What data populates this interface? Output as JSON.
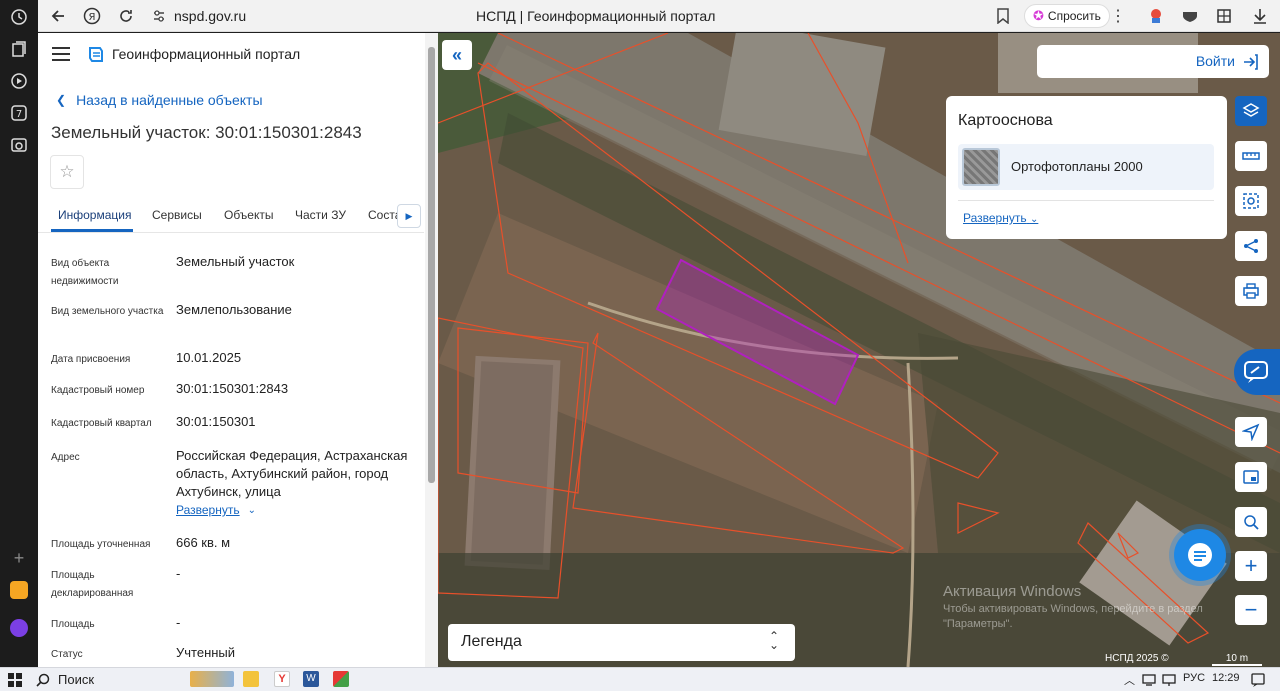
{
  "browser": {
    "url": "nspd.gov.ru",
    "page_title": "НСПД | Геоинформационный портал",
    "ask_label": "Спросить"
  },
  "panel": {
    "portal_name": "Геоинформационный портал",
    "back_label": "Назад в найденные объекты",
    "title": "Земельный участок: 30:01:150301:2843",
    "tabs": [
      "Информация",
      "Сервисы",
      "Объекты",
      "Части ЗУ",
      "Соста"
    ],
    "fields": [
      {
        "label": "Вид объекта недвижимости",
        "value": "Земельный участок"
      },
      {
        "label": "Вид земельного участка",
        "value": "Землепользование"
      },
      {
        "label": "Дата присвоения",
        "value": "10.01.2025"
      },
      {
        "label": "Кадастровый номер",
        "value": "30:01:150301:2843"
      },
      {
        "label": "Кадастровый квартал",
        "value": "30:01:150301"
      },
      {
        "label": "Адрес",
        "value": "Российская Федерация, Астраханская область, Ахтубинский район, город Ахтубинск, улица"
      },
      {
        "label": "Площадь уточненная",
        "value": "666 кв. м"
      },
      {
        "label": "Площадь декларированная",
        "value": "-"
      },
      {
        "label": "Площадь",
        "value": "-"
      },
      {
        "label": "Статус",
        "value": "Учтенный"
      }
    ],
    "address_expand": "Развернуть"
  },
  "map": {
    "login_label": "Войти",
    "basemap_title": "Картооснова",
    "basemap_item": "Ортофотопланы 2000",
    "basemap_expand": "Развернуть",
    "legend_label": "Легенда",
    "watermark_line1": "Активация Windows",
    "watermark_line2": "Чтобы активировать Windows, перейдите в раздел",
    "watermark_line3": "\"Параметры\".",
    "copyright": "НСПД 2025 ©",
    "scale": "10 m",
    "parcel_color": "#b020c0",
    "boundary_color": "#e8502a",
    "accent": "#1565c0"
  },
  "taskbar": {
    "search_label": "Поиск",
    "lang": "РУС",
    "time": "12:29"
  }
}
